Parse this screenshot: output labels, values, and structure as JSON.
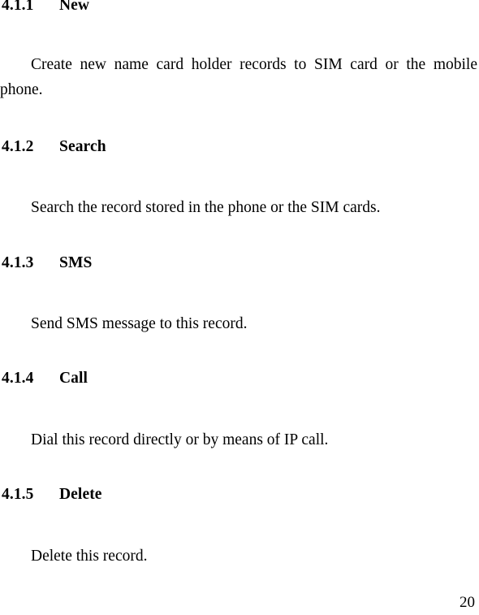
{
  "document": {
    "sections": [
      {
        "number": "4.1.1",
        "title": "New",
        "body": "Create new name card holder records to SIM card or the mobile phone."
      },
      {
        "number": "4.1.2",
        "title": "Search",
        "body": "Search the record stored in the phone or the SIM cards."
      },
      {
        "number": "4.1.3",
        "title": "SMS",
        "body": "Send SMS message to this record."
      },
      {
        "number": "4.1.4",
        "title": "Call",
        "body": "Dial this record directly or by means of IP call."
      },
      {
        "number": "4.1.5",
        "title": "Delete",
        "body": "Delete this record."
      }
    ],
    "footer": {
      "page_number": "20"
    }
  }
}
